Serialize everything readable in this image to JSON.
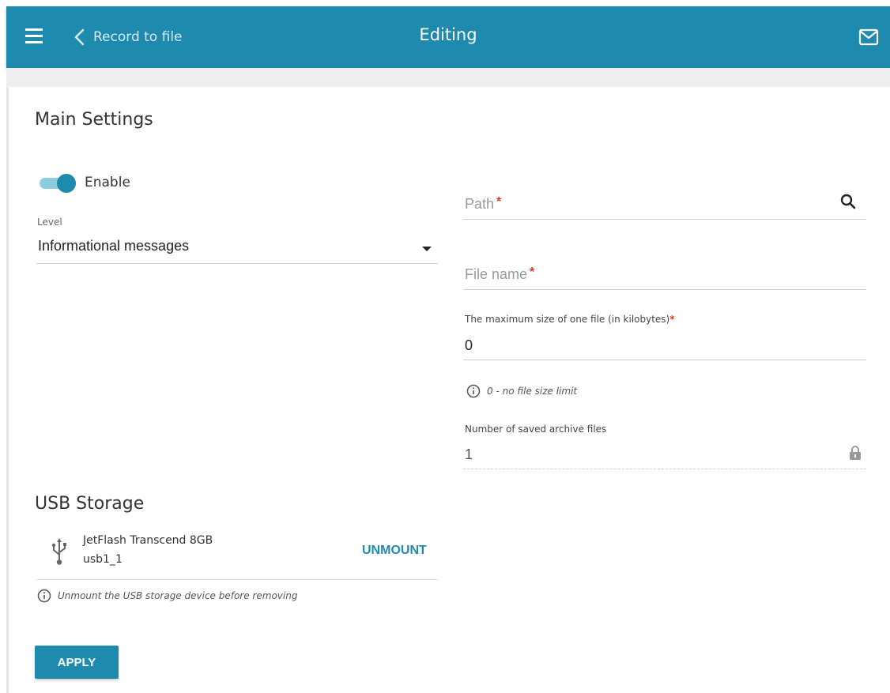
{
  "header": {
    "back_label": "Record to file",
    "title": "Editing"
  },
  "main_settings": {
    "title": "Main Settings",
    "enable_label": "Enable",
    "enabled": true,
    "level_label": "Level",
    "level_value": "Informational messages"
  },
  "right_form": {
    "path_label": "Path",
    "path_required_mark": "*",
    "path_value": "",
    "file_name_label": "File name",
    "file_name_required_mark": "*",
    "file_name_value": "",
    "max_size_label": "The maximum size of one file (in kilobytes)",
    "max_size_required_mark": "*",
    "max_size_value": "0",
    "max_size_hint": "0 - no file size limit",
    "archive_label": "Number of saved archive files",
    "archive_value": "1"
  },
  "usb_storage": {
    "title": "USB Storage",
    "device_name": "JetFlash Transcend 8GB",
    "device_id": "usb1_1",
    "unmount_label": "UNMOUNT",
    "hint": "Unmount the USB storage device before removing"
  },
  "actions": {
    "apply_label": "APPLY"
  },
  "colors": {
    "accent": "#1e8aae",
    "required": "#d83a1e"
  },
  "icons": [
    "menu-icon",
    "chevron-left-icon",
    "mail-icon",
    "search-icon",
    "info-icon",
    "lock-icon",
    "usb-icon",
    "dropdown-caret-icon"
  ]
}
